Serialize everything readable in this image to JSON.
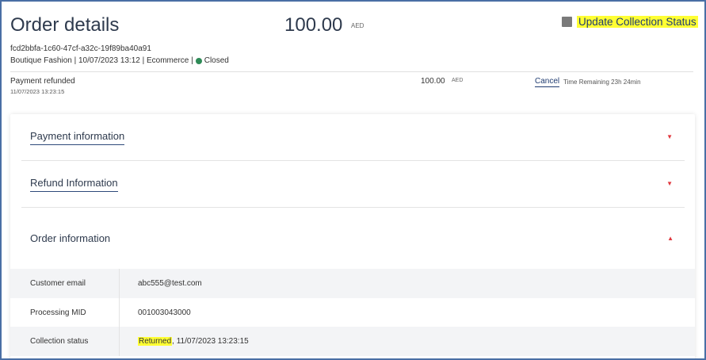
{
  "header": {
    "title": "Order details",
    "amount": "100.00",
    "currency": "AED",
    "update_status_label": "Update Collection Status",
    "order_id": "fcd2bbfa-1c60-47cf-a32c-19f89ba40a91",
    "meta_prefix": "Boutique Fashion | 10/07/2023 13:12 | Ecommerce |",
    "status": "Closed",
    "status_color": "#2e8b57"
  },
  "transaction": {
    "label": "Payment refunded",
    "timestamp": "11/07/2023 13:23:15",
    "amount": "100.00",
    "currency": "AED",
    "cancel_label": "Cancel",
    "time_remaining": "Time Remaining 23h 24min"
  },
  "sections": [
    {
      "title": "Payment information",
      "expanded": false
    },
    {
      "title": "Refund Information",
      "expanded": false
    },
    {
      "title": "Order information",
      "expanded": true
    }
  ],
  "order_information": {
    "rows": [
      {
        "key": "Customer email",
        "value": "abc555@test.com"
      },
      {
        "key": "Processing MID",
        "value": "001003043000"
      },
      {
        "key": "Collection status",
        "value_highlight": "Returned",
        "value_rest": ", 11/07/2023 13:23:15"
      }
    ]
  },
  "colors": {
    "accent": "#1f3b70",
    "arrow": "#e0383e",
    "highlight": "#ffff33"
  }
}
